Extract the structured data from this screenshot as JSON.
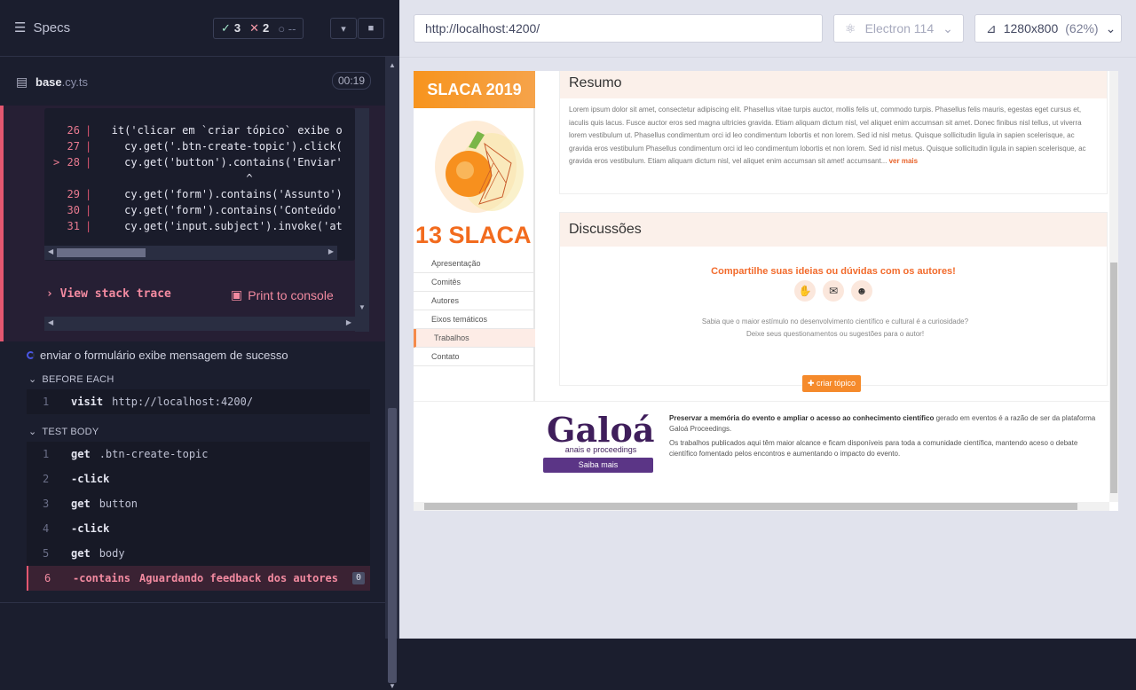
{
  "specs": {
    "title": "Specs",
    "passed": "3",
    "failed": "2",
    "pending": "--"
  },
  "file": {
    "name": "base",
    "ext": ".cy.ts",
    "time": "00:19"
  },
  "code": {
    "lines": [
      {
        "num": "26",
        "text": "  it('clicar em `criar tópico` exibe o"
      },
      {
        "num": "27",
        "text": "    cy.get('.btn-create-topic').click("
      },
      {
        "num": "28",
        "text": "    cy.get('button').contains('Enviar'"
      },
      {
        "num": "",
        "text": "                       ^"
      },
      {
        "num": "29",
        "text": "    cy.get('form').contains('Assunto')"
      },
      {
        "num": "30",
        "text": "    cy.get('form').contains('Conteúdo'"
      },
      {
        "num": "31",
        "text": "    cy.get('input.subject').invoke('at"
      }
    ]
  },
  "error": {
    "stack_trace": "View stack trace",
    "print_console": "Print to console"
  },
  "test": {
    "title": "enviar o formulário exibe mensagem de sucesso",
    "before_each": "BEFORE EACH",
    "test_body": "TEST BODY",
    "before_cmds": [
      {
        "num": "1",
        "name": "visit",
        "msg": "http://localhost:4200/"
      }
    ],
    "body_cmds": [
      {
        "num": "1",
        "name": "get",
        "msg": ".btn-create-topic"
      },
      {
        "num": "2",
        "name": "-click",
        "msg": ""
      },
      {
        "num": "3",
        "name": "get",
        "msg": "button"
      },
      {
        "num": "4",
        "name": "-click",
        "msg": ""
      },
      {
        "num": "5",
        "name": "get",
        "msg": "body"
      },
      {
        "num": "6",
        "name": "-contains",
        "msg": "Aguardando feedback dos autores",
        "badge": "0"
      }
    ]
  },
  "browser": {
    "url": "http://localhost:4200/",
    "name": "Electron 114",
    "viewport": "1280x800",
    "zoom": "(62%)"
  },
  "aut": {
    "brand": "SLACA 2019",
    "logo_text": "13 SLACA",
    "nav": [
      "Apresentação",
      "Comitês",
      "Autores",
      "Eixos temáticos",
      "Trabalhos",
      "Contato"
    ],
    "resumo_title": "Resumo",
    "resumo_text": "Lorem ipsum dolor sit amet, consectetur adipiscing elit. Phasellus vitae turpis auctor, mollis felis ut, commodo turpis. Phasellus felis mauris, egestas eget cursus et, iaculis quis lacus. Fusce auctor eros sed magna ultricies gravida. Etiam aliquam dictum nisl, vel aliquet enim accumsan sit amet. Donec finibus nisl tellus, ut viverra lorem vestibulum ut. Phasellus condimentum orci id leo condimentum lobortis et non lorem. Sed id nisl metus. Quisque sollicitudin ligula in sapien scelerisque, ac gravida eros vestibulum Phasellus condimentum orci id leo condimentum lobortis et non lorem. Sed id nisl metus. Quisque sollicitudin ligula in sapien scelerisque, ac gravida eros vestibulum. Etiam aliquam dictum nisl, vel aliquet enim accumsan sit amet! accumsant...",
    "ver_mais": "ver mais",
    "discussoes_title": "Discussões",
    "share_title": "Compartilhe suas ideias ou dúvidas com os autores!",
    "share_text": "Sabia que o maior estímulo no desenvolvimento científico e cultural é a curiosidade? Deixe seus questionamentos ou sugestões para o autor!",
    "criar_btn": "criar tópico",
    "galoa": "Galoá",
    "galoa_sub": "anais e proceedings",
    "saiba_mais": "Saiba mais",
    "footer_bold": "Preservar a memória do evento e ampliar o acesso ao conhecimento científico",
    "footer_rest": " gerado em eventos é a razão de ser da plataforma Galoá Proceedings.",
    "footer_p2": "Os trabalhos publicados aqui têm maior alcance e ficam disponíveis para toda a comunidade científica, mantendo aceso o debate científico fomentado pelos encontros e aumentando o impacto do evento."
  }
}
